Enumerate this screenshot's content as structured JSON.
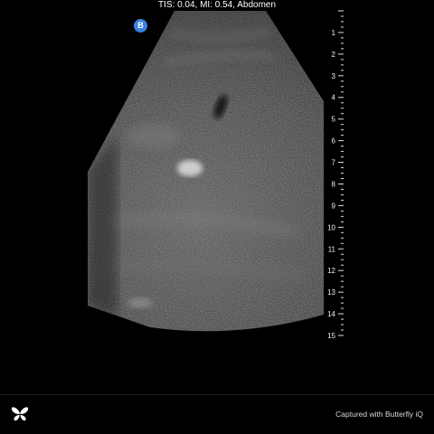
{
  "header": {
    "text": "TIS: 0.04, MI: 0.54, Abdomen"
  },
  "probe_badge": {
    "label": "B",
    "color": "#3b82e6"
  },
  "depth_scale": {
    "labels": [
      "1",
      "2",
      "3",
      "4",
      "5",
      "6",
      "7",
      "8",
      "9",
      "10",
      "11",
      "12",
      "13",
      "14",
      "15"
    ],
    "max_depth": 15,
    "minor_ticks_per_unit": 4
  },
  "footer": {
    "logo_icon": "butterfly-logo-icon",
    "caption": "Captured with Butterfly iQ"
  }
}
